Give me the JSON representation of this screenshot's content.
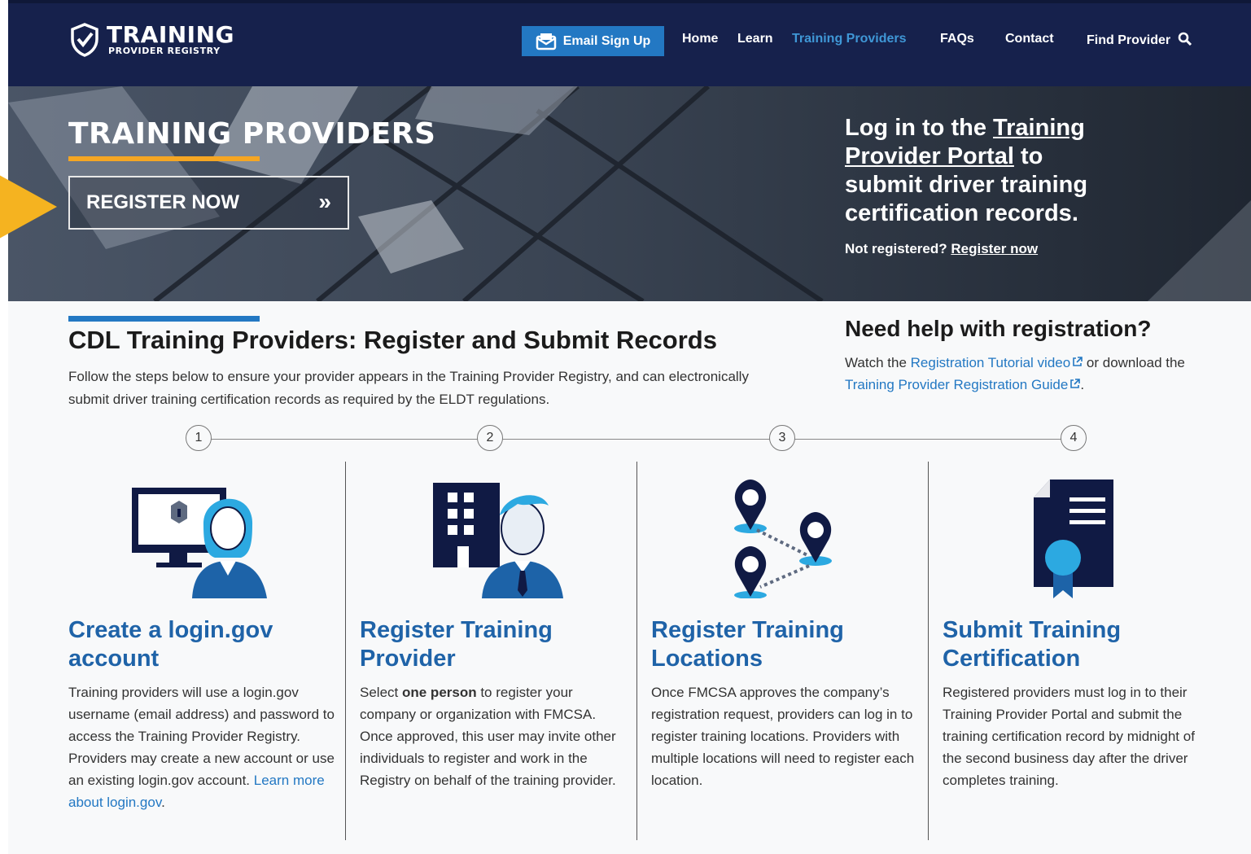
{
  "header": {
    "logo_title": "TRAINING",
    "logo_sub": "PROVIDER REGISTRY",
    "email_button": "Email Sign Up",
    "nav": [
      "Home",
      "Learn",
      "Training Providers",
      "FAQs",
      "Contact",
      "Find Provider"
    ],
    "active_nav": "Training Providers"
  },
  "hero": {
    "title": "TRAINING PROVIDERS",
    "register_button": "REGISTER NOW",
    "register_chevron": "»",
    "login_part1": "Log in to the ",
    "login_link": "Training Provider Portal",
    "login_part2": " to submit driver training certification records.",
    "notreg_text": "Not registered? ",
    "notreg_link": "Register now"
  },
  "main": {
    "title": "CDL Training Providers: Register and Submit Records",
    "description": "Follow the steps below to ensure your provider appears in the Training Provider Registry, and can electronically submit driver training certification records as required by the ELDT regulations."
  },
  "help": {
    "title": "Need help with registration?",
    "text1": "Watch the ",
    "link1": "Registration Tutorial video",
    "text2": " or download the ",
    "link2": "Training Provider Registration Guide",
    "text3": "."
  },
  "steps": {
    "numbers": [
      "1",
      "2",
      "3",
      "4"
    ],
    "columns": [
      {
        "title": "Create a login.gov account",
        "desc": "Training providers will use a login.gov username (email address) and password to access the Training Provider Registry. Providers may create a new account or use an existing login.gov account. ",
        "link": "Learn more about login.gov",
        "tail": "."
      },
      {
        "title": "Register Training Provider",
        "desc_pre": "Select ",
        "desc_bold": "one person",
        "desc_post": " to register your company or organization with FMCSA. Once approved, this user may invite other individuals to register and work in the Registry on behalf of the training provider."
      },
      {
        "title": "Register Training Locations",
        "desc": "Once FMCSA approves the company’s registration request, providers can log in to register training locations. Providers with multiple locations will need to register each location."
      },
      {
        "title": "Submit Training Certification",
        "desc": "Registered providers must log in to their Training Provider Portal and submit the training certification record by midnight of the second business day after the driver completes training."
      }
    ]
  },
  "colors": {
    "navy": "#16214c",
    "accent_blue": "#2378c3",
    "orange": "#f5a623",
    "light_blue": "#3f97d6"
  },
  "icons": [
    "shield-icon",
    "envelope-icon",
    "search-icon",
    "external-link-icon",
    "computer-woman-icon",
    "building-man-icon",
    "map-pins-icon",
    "certificate-icon",
    "arrow-indicator-icon"
  ]
}
